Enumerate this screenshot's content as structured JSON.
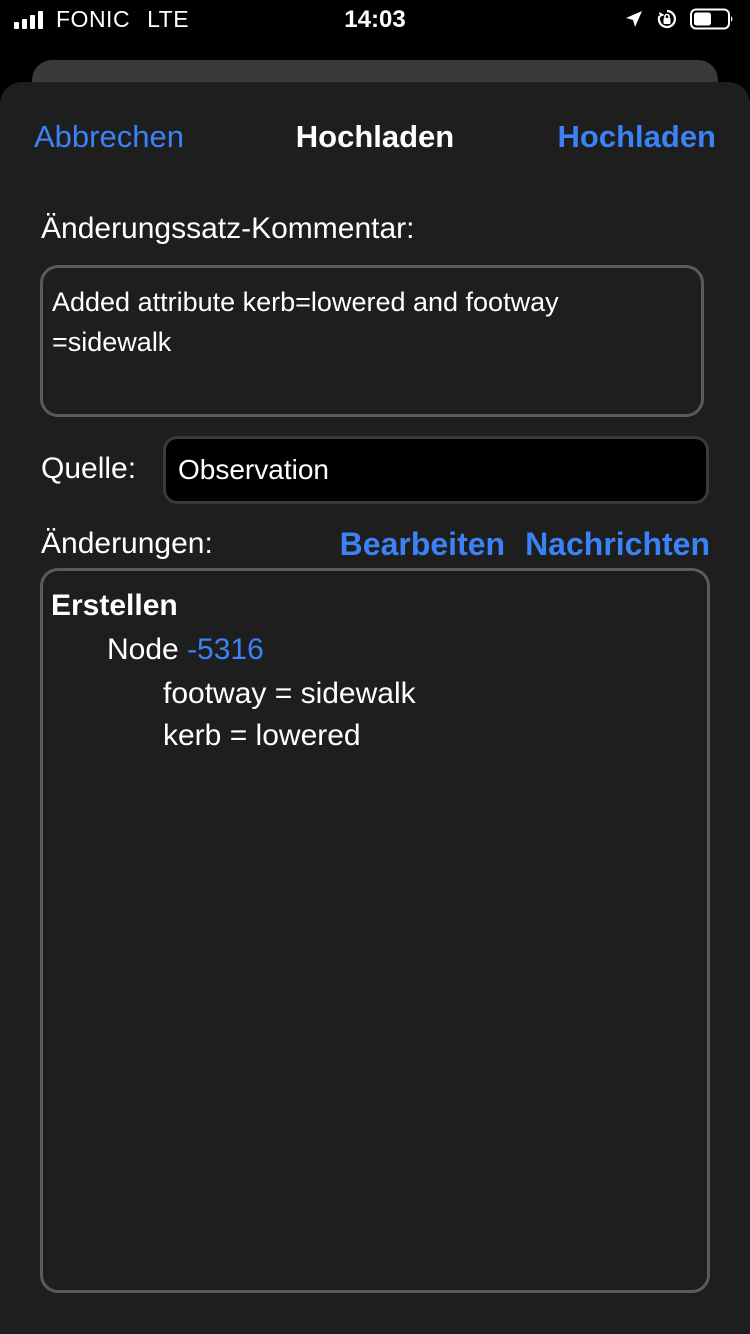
{
  "status_bar": {
    "carrier": "FONIC",
    "network": "LTE",
    "time": "14:03",
    "icons": [
      "signal-icon",
      "location-arrow-icon",
      "orientation-lock-icon",
      "battery-icon"
    ]
  },
  "nav": {
    "cancel_label": "Abbrechen",
    "title": "Hochladen",
    "upload_label": "Hochladen"
  },
  "comment": {
    "label": "Änderungssatz-Kommentar:",
    "value": "Added attribute kerb=lowered and footway\n=sidewalk"
  },
  "source": {
    "label": "Quelle:",
    "value": "Observation"
  },
  "changes": {
    "label": "Änderungen:",
    "edit_label": "Bearbeiten",
    "messages_label": "Nachrichten",
    "group_heading": "Erstellen",
    "node_prefix": "Node",
    "node_id": "-5316",
    "tags": [
      "footway = sidewalk",
      "kerb = lowered"
    ]
  },
  "colors": {
    "accent": "#3b82f6",
    "sheet_background": "#1e1e1e",
    "border": "#5b5b5e"
  }
}
